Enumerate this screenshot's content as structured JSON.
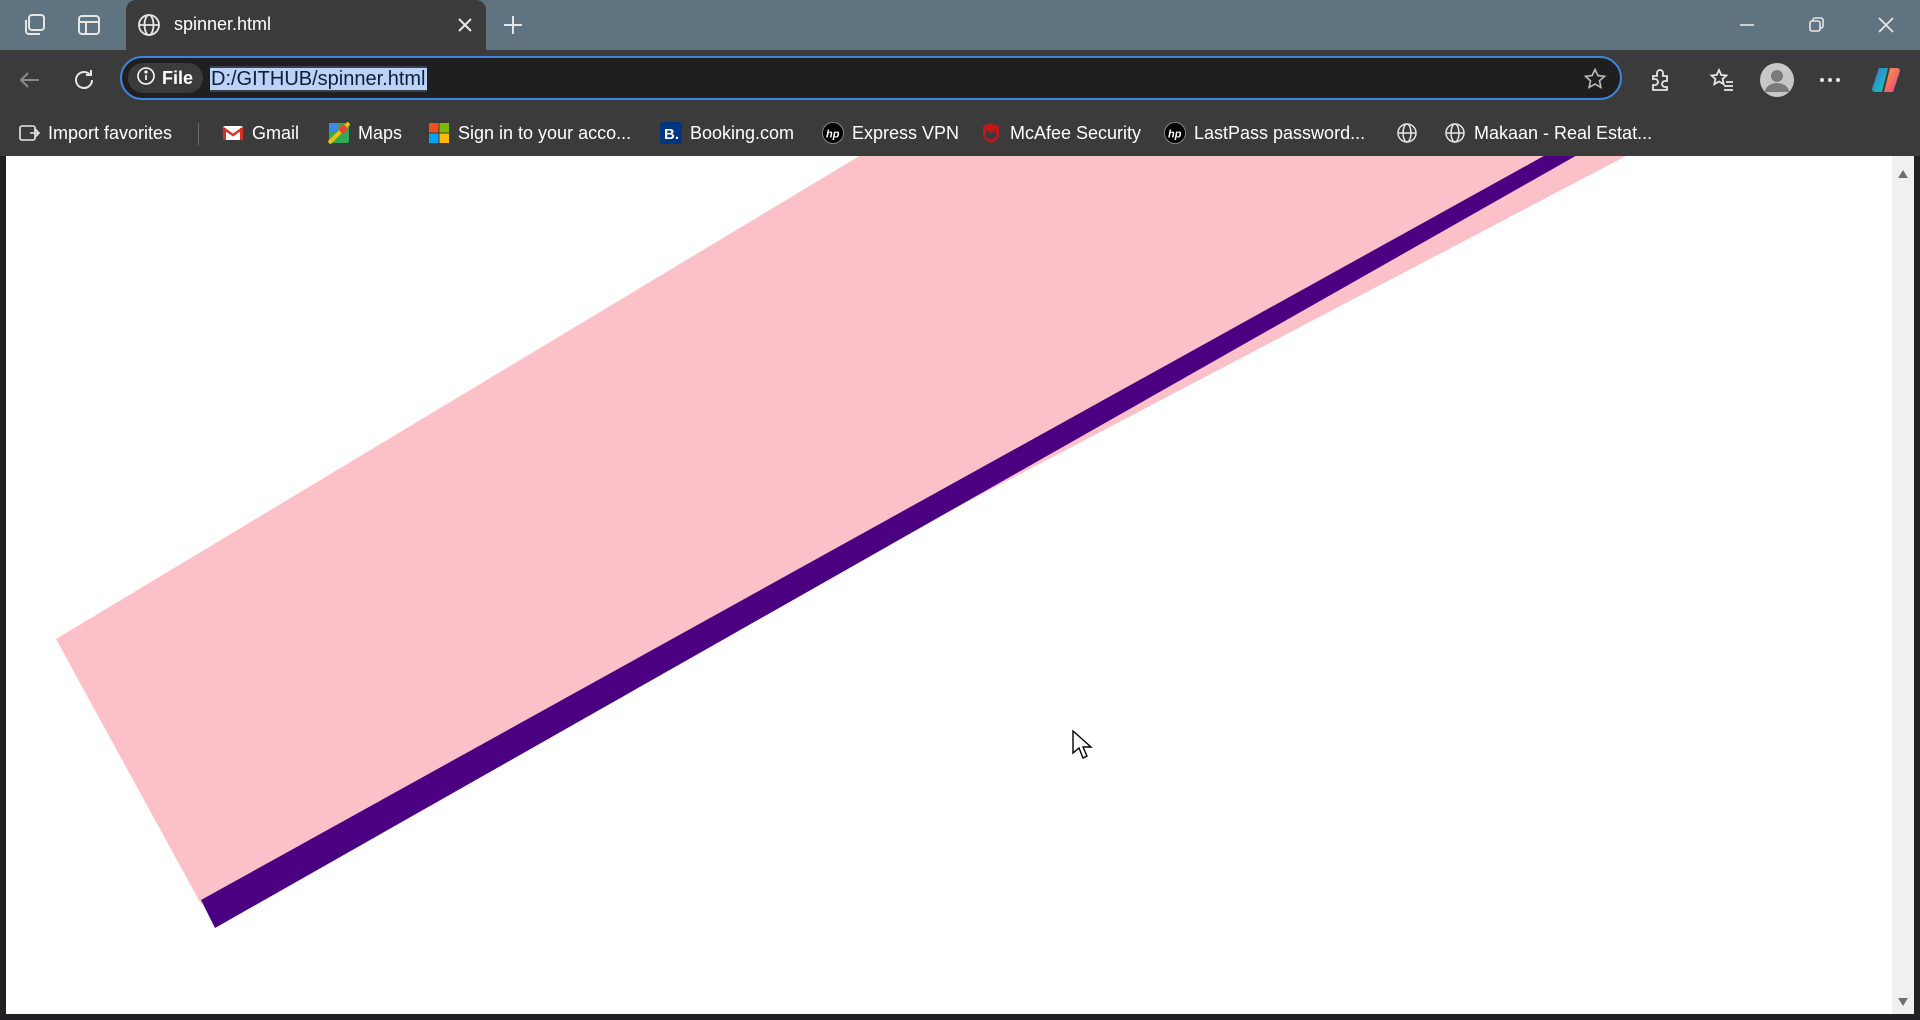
{
  "browser": {
    "tab": {
      "title": "spinner.html"
    },
    "address_bar": {
      "site_chip_label": "File",
      "url": "D:/GITHUB/spinner.html"
    },
    "bookmarks": [
      {
        "label": "Import favorites",
        "icon": "import-icon"
      },
      {
        "label": "Gmail",
        "icon": "gmail-icon"
      },
      {
        "label": "Maps",
        "icon": "maps-icon"
      },
      {
        "label": "Sign in to your acco...",
        "icon": "microsoft-icon"
      },
      {
        "label": "Booking.com",
        "icon": "booking-icon"
      },
      {
        "label": "Express VPN",
        "icon": "hp-icon"
      },
      {
        "label": "McAfee Security",
        "icon": "mcafee-icon"
      },
      {
        "label": "LastPass password...",
        "icon": "hp-icon"
      },
      {
        "label": "",
        "icon": "globe-icon"
      },
      {
        "label": "Makaan - Real Estat...",
        "icon": "globe-icon"
      }
    ]
  },
  "page": {
    "shape_colors": {
      "band": "#fcc0c8",
      "edge": "#4b0082"
    }
  },
  "colors": {
    "titlebar": "#5f7480",
    "toolbar": "#3b3b3b",
    "focus_ring": "#3f86e3",
    "icon": "#e6e6e6"
  }
}
